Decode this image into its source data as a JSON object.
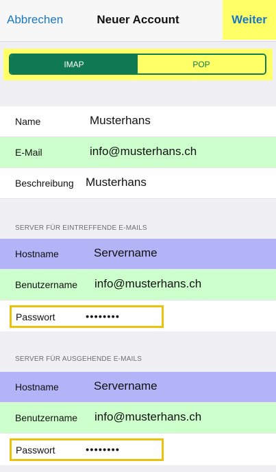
{
  "nav": {
    "cancel_label": "Abbrechen",
    "title": "Neuer Account",
    "next_label": "Weiter"
  },
  "segment": {
    "options": [
      "IMAP",
      "POP"
    ],
    "selected": "IMAP"
  },
  "account": {
    "name_label": "Name",
    "name_value": "Musterhans",
    "email_label": "E-Mail",
    "email_value": "info@musterhans.ch",
    "description_label": "Beschreibung",
    "description_value": "Musterhans"
  },
  "incoming": {
    "header": "SERVER FÜR EINTREFFENDE E-MAILS",
    "hostname_label": "Hostname",
    "hostname_value": "Servername",
    "username_label": "Benutzername",
    "username_value": "info@musterhans.ch",
    "password_label": "Passwort",
    "password_value": "••••••••"
  },
  "outgoing": {
    "header": "SERVER FÜR AUSGEHENDE E-MAILS",
    "hostname_label": "Hostname",
    "hostname_value": "Servername",
    "username_label": "Benutzername",
    "username_value": "info@musterhans.ch",
    "password_label": "Passwort",
    "password_value": "••••••••"
  },
  "colors": {
    "link": "#1a78c2",
    "highlight_yellow": "#ffff66",
    "segment_green": "#0f7a52",
    "row_green": "#ccffcc",
    "row_blue": "#b3b3f7",
    "outline_gold": "#e8c20c"
  }
}
